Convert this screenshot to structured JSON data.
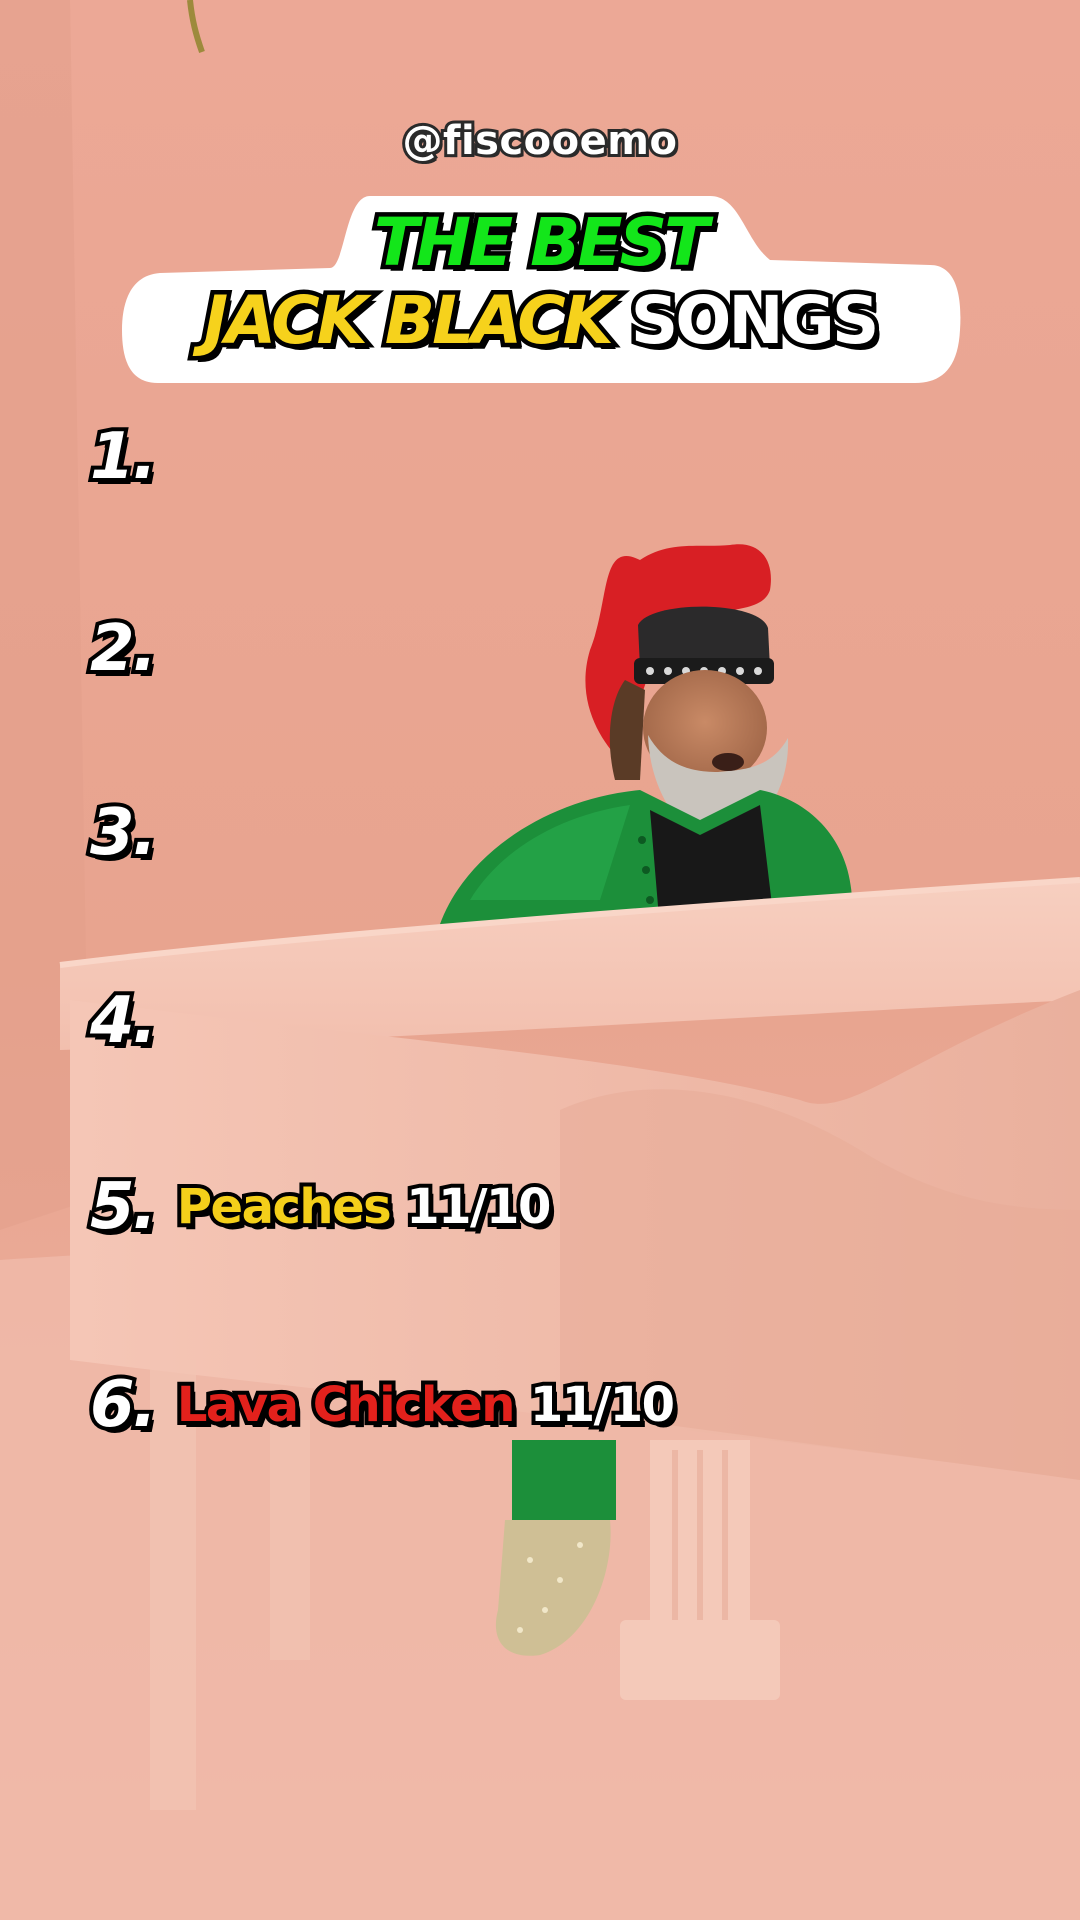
{
  "overlay": {
    "handle": "@fiscooemo",
    "title": {
      "line1": "THE BEST",
      "line2_highlight": "JACK BLACK",
      "line2_rest": "SONGS"
    },
    "ranking": [
      {
        "number": "1.",
        "song": "",
        "score": ""
      },
      {
        "number": "2.",
        "song": "",
        "score": ""
      },
      {
        "number": "3.",
        "song": "",
        "score": ""
      },
      {
        "number": "4.",
        "song": "",
        "score": ""
      },
      {
        "number": "5.",
        "song": "Peaches",
        "score": "11/10"
      },
      {
        "number": "6.",
        "song": "Lava Chicken",
        "score": "11/10"
      }
    ]
  },
  "colors": {
    "background": "#e9a592",
    "title_green": "#13e61a",
    "title_yellow": "#f6d21c",
    "title_white": "#ffffff",
    "song_yellow": "#f4cf1a",
    "song_red": "#e2211c",
    "jacket": "#1c8f3a",
    "hair": "#d81f24",
    "piano": "#f3c2b2"
  }
}
